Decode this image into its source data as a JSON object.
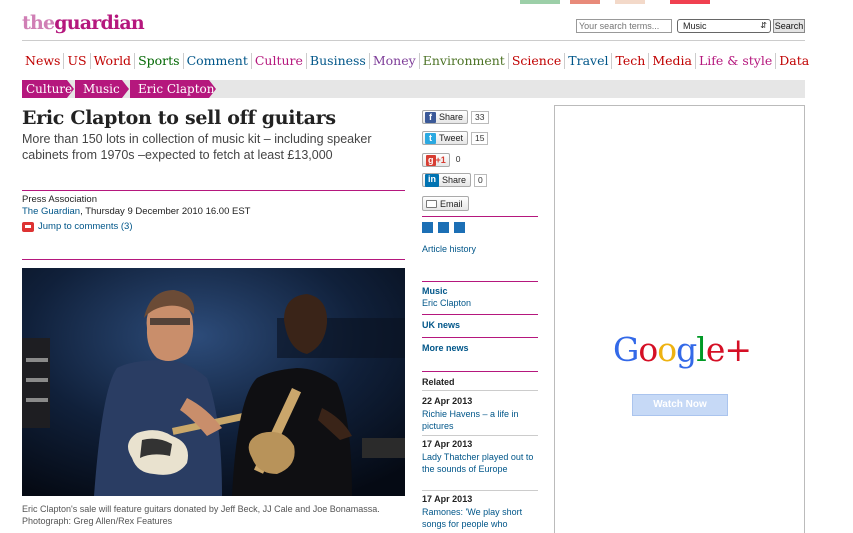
{
  "brand": {
    "logo": "theguardian",
    "accent": "#b5177d",
    "link_color": "#005689"
  },
  "search": {
    "placeholder": "Your search terms...",
    "section": "Music",
    "button": "Search"
  },
  "nav": [
    {
      "label": "News",
      "color": "#c00000"
    },
    {
      "label": "US",
      "color": "#c00000"
    },
    {
      "label": "World",
      "color": "#c00000"
    },
    {
      "label": "Sports",
      "color": "#006600"
    },
    {
      "label": "Comment",
      "color": "#005689"
    },
    {
      "label": "Culture",
      "color": "#b5177d"
    },
    {
      "label": "Business",
      "color": "#005689"
    },
    {
      "label": "Money",
      "color": "#7d3c98"
    },
    {
      "label": "Environment",
      "color": "#4d7326"
    },
    {
      "label": "Science",
      "color": "#c00000"
    },
    {
      "label": "Travel",
      "color": "#005689"
    },
    {
      "label": "Tech",
      "color": "#c00000"
    },
    {
      "label": "Media",
      "color": "#c00000"
    },
    {
      "label": "Life & style",
      "color": "#b5177d"
    },
    {
      "label": "Data",
      "color": "#c00000"
    }
  ],
  "breadcrumb": [
    "Culture",
    "Music",
    "Eric Clapton"
  ],
  "article": {
    "headline": "Eric Clapton to sell off guitars",
    "standfirst": "More than 150 lots in collection of music kit – including speaker cabinets from 1970s –expected to fetch at least £13,000",
    "byline_source": "Press Association",
    "publication": "The Guardian",
    "date": ", Thursday 9 December 2010 16.00 EST",
    "comments_link": "Jump to comments (3)",
    "caption": "Eric Clapton's sale will feature guitars donated by Jeff Beck, JJ Cale and Joe Bonamassa. Photograph: Greg Allen/Rex Features"
  },
  "share": {
    "facebook": {
      "label": "Share",
      "count": "33"
    },
    "twitter": {
      "label": "Tweet",
      "count": "15"
    },
    "gplus": {
      "label": "+1",
      "count": "0"
    },
    "linkedin": {
      "label": "Share",
      "count": "0"
    },
    "email": {
      "label": "Email"
    }
  },
  "sidebar": {
    "article_history": "Article history",
    "music_heading": "Music",
    "music_link": "Eric Clapton",
    "uk_news": "UK news",
    "more_news": "More news",
    "related_heading": "Related",
    "related": [
      {
        "date": "22 Apr 2013",
        "title": "Richie Havens – a life in pictures"
      },
      {
        "date": "17 Apr 2013",
        "title": "Lady Thatcher played out to the sounds of Europe"
      },
      {
        "date": "17 Apr 2013",
        "title": "Ramones: 'We play short songs for people who"
      }
    ]
  },
  "ad": {
    "logo": "Google+",
    "button": "Watch Now"
  }
}
